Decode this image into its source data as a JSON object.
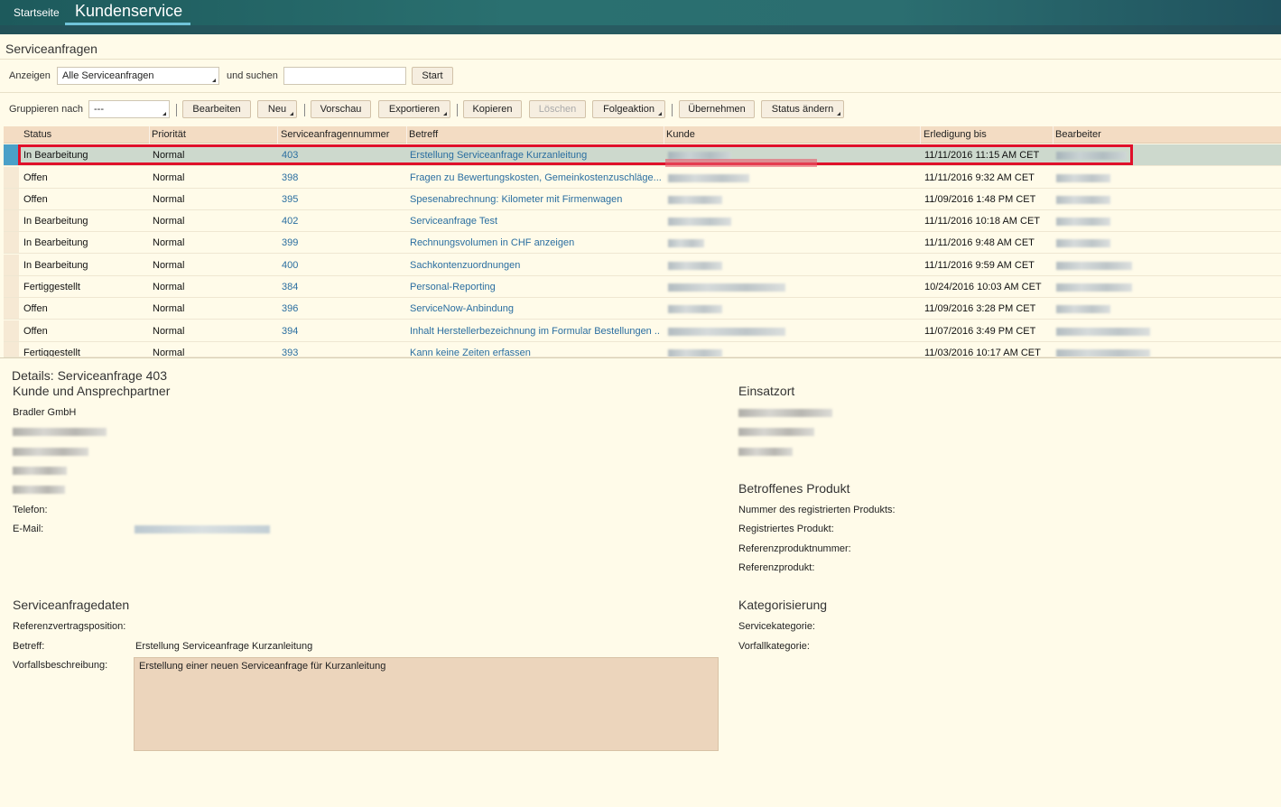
{
  "nav": {
    "home": "Startseite",
    "current": "Kundenservice"
  },
  "page_title": "Serviceanfragen",
  "filter": {
    "show_label": "Anzeigen",
    "show_value": "Alle Serviceanfragen",
    "search_label": "und suchen",
    "search_value": "",
    "start": "Start"
  },
  "toolbar": {
    "group_label": "Gruppieren nach",
    "group_value": "---",
    "edit": "Bearbeiten",
    "new": "Neu",
    "preview": "Vorschau",
    "export": "Exportieren",
    "copy": "Kopieren",
    "delete": "Löschen",
    "followup": "Folgeaktion",
    "take_over": "Übernehmen",
    "change_status": "Status ändern"
  },
  "table": {
    "headers": [
      "Status",
      "Priorität",
      "Serviceanfragennummer",
      "Betreff",
      "Kunde",
      "Erledigung bis",
      "Bearbeiter"
    ],
    "rows": [
      {
        "status": "In Bearbeitung",
        "priority": "Normal",
        "number": "403",
        "subject": "Erstellung Serviceanfrage Kurzanleitung",
        "due": "11/11/2016 11:15 AM CET"
      },
      {
        "status": "Offen",
        "priority": "Normal",
        "number": "398",
        "subject": "Fragen zu Bewertungskosten, Gemeinkostenzuschläge...",
        "due": "11/11/2016 9:32 AM CET"
      },
      {
        "status": "Offen",
        "priority": "Normal",
        "number": "395",
        "subject": "Spesenabrechnung: Kilometer mit Firmenwagen",
        "due": "11/09/2016 1:48 PM CET"
      },
      {
        "status": "In Bearbeitung",
        "priority": "Normal",
        "number": "402",
        "subject": "Serviceanfrage Test",
        "due": "11/11/2016 10:18 AM CET"
      },
      {
        "status": "In Bearbeitung",
        "priority": "Normal",
        "number": "399",
        "subject": "Rechnungsvolumen in CHF anzeigen",
        "due": "11/11/2016 9:48 AM CET"
      },
      {
        "status": "In Bearbeitung",
        "priority": "Normal",
        "number": "400",
        "subject": "Sachkontenzuordnungen",
        "due": "11/11/2016 9:59 AM CET"
      },
      {
        "status": "Fertiggestellt",
        "priority": "Normal",
        "number": "384",
        "subject": "Personal-Reporting",
        "due": "10/24/2016 10:03 AM CET"
      },
      {
        "status": "Offen",
        "priority": "Normal",
        "number": "396",
        "subject": "ServiceNow-Anbindung",
        "due": "11/09/2016 3:28 PM CET"
      },
      {
        "status": "Offen",
        "priority": "Normal",
        "number": "394",
        "subject": "Inhalt Herstellerbezeichnung im Formular Bestellungen ...",
        "due": "11/07/2016 3:49 PM CET"
      },
      {
        "status": "Fertiggestellt",
        "priority": "Normal",
        "number": "393",
        "subject": "Kann keine Zeiten erfassen",
        "due": "11/03/2016 10:17 AM CET"
      }
    ]
  },
  "details": {
    "title": "Details: Serviceanfrage 403",
    "customer_section": "Kunde und Ansprechpartner",
    "customer_name": "Bradler GmbH",
    "phone_label": "Telefon:",
    "email_label": "E-Mail:",
    "location_section": "Einsatzort",
    "product_section": "Betroffenes Produkt",
    "product_fields": [
      "Nummer des registrierten Produkts:",
      "Registriertes Produkt:",
      "Referenzproduktnummer:",
      "Referenzprodukt:"
    ],
    "data_section": "Serviceanfragedaten",
    "ref_contract_label": "Referenzvertragsposition:",
    "subject_label": "Betreff:",
    "subject_value": "Erstellung Serviceanfrage Kurzanleitung",
    "description_label": "Vorfallsbeschreibung:",
    "description_value": "Erstellung einer neuen Serviceanfrage für Kurzanleitung",
    "category_section": "Kategorisierung",
    "service_category_label": "Servicekategorie:",
    "incident_category_label": "Vorfallkategorie:"
  }
}
